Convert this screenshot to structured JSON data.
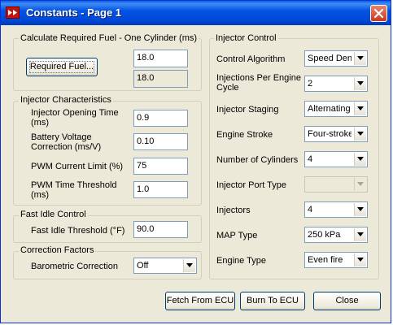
{
  "window": {
    "title": "Constants - Page 1"
  },
  "fuel_group": {
    "legend": "Calculate Required Fuel - One Cylinder (ms)",
    "button_label": "Required Fuel...",
    "value1": "18.0",
    "value2": "18.0"
  },
  "injector_char": {
    "legend": "Injector Characteristics",
    "opening_time_label_1": "Injector Opening Time",
    "opening_time_label_2": "(ms)",
    "opening_time": "0.9",
    "battery_label_1": "Battery Voltage",
    "battery_label_2": "Correction (ms/V)",
    "battery": "0.10",
    "pwm_limit_label": "PWM Current Limit (%)",
    "pwm_limit": "75",
    "pwm_threshold_label_1": "PWM Time Threshold",
    "pwm_threshold_label_2": "(ms)",
    "pwm_threshold": "1.0"
  },
  "fast_idle": {
    "legend": "Fast Idle Control",
    "threshold_label": "Fast Idle Threshold (°F)",
    "threshold": "90.0"
  },
  "correction": {
    "legend": "Correction Factors",
    "baro_label": "Barometric Correction",
    "baro": "Off"
  },
  "injector_control": {
    "legend": "Injector Control",
    "control_algorithm_label": "Control Algorithm",
    "control_algorithm": "Speed Density",
    "injections_label_1": "Injections Per Engine",
    "injections_label_2": "Cycle",
    "injections": "2",
    "staging_label": "Injector Staging",
    "staging": "Alternating",
    "stroke_label": "Engine Stroke",
    "stroke": "Four-stroke",
    "cylinders_label": "Number of Cylinders",
    "cylinders": "4",
    "port_type_label": "Injector Port Type",
    "port_type": "",
    "injectors_label": "Injectors",
    "injectors": "4",
    "map_type_label": "MAP Type",
    "map_type": "250 kPa",
    "engine_type_label": "Engine Type",
    "engine_type": "Even fire"
  },
  "buttons": {
    "fetch": "Fetch From ECU",
    "burn": "Burn To ECU",
    "close": "Close"
  }
}
